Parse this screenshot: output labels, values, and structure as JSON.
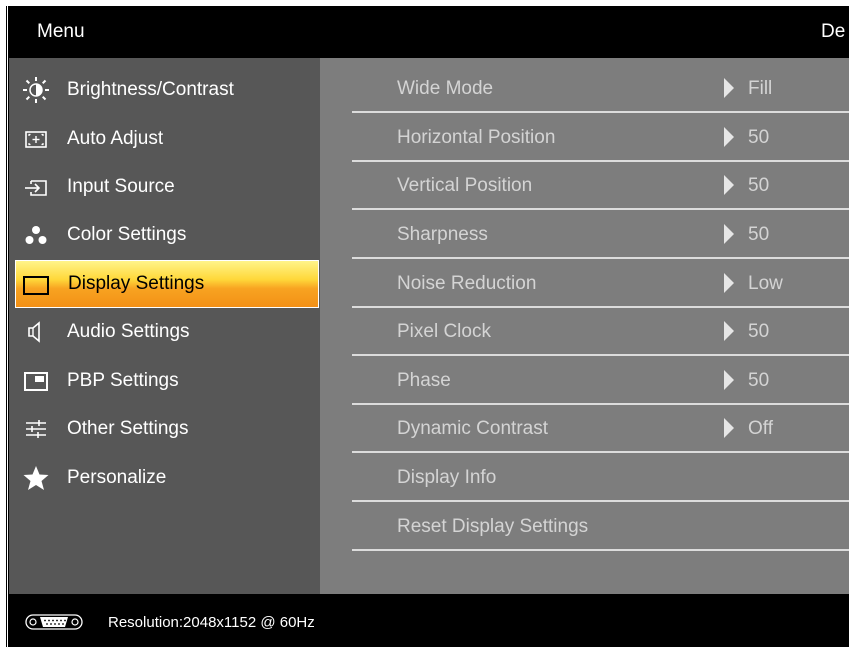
{
  "header": {
    "menu_title": "Menu",
    "brand_partial": "De"
  },
  "sidebar": {
    "items": [
      {
        "label": "Brightness/Contrast",
        "icon": "brightness-icon",
        "selected": false
      },
      {
        "label": "Auto Adjust",
        "icon": "auto-adjust-icon",
        "selected": false
      },
      {
        "label": "Input Source",
        "icon": "input-source-icon",
        "selected": false
      },
      {
        "label": "Color Settings",
        "icon": "color-settings-icon",
        "selected": false
      },
      {
        "label": "Display Settings",
        "icon": "display-settings-icon",
        "selected": true
      },
      {
        "label": "Audio Settings",
        "icon": "speaker-icon",
        "selected": false
      },
      {
        "label": "PBP Settings",
        "icon": "pbp-icon",
        "selected": false
      },
      {
        "label": "Other Settings",
        "icon": "sliders-icon",
        "selected": false
      },
      {
        "label": "Personalize",
        "icon": "star-icon",
        "selected": false
      }
    ]
  },
  "display_settings": {
    "rows": [
      {
        "label": "Wide Mode",
        "value": "Fill"
      },
      {
        "label": "Horizontal Position",
        "value": "50"
      },
      {
        "label": "Vertical Position",
        "value": "50"
      },
      {
        "label": "Sharpness",
        "value": "50"
      },
      {
        "label": "Noise Reduction",
        "value": "Low"
      },
      {
        "label": "Pixel Clock",
        "value": "50"
      },
      {
        "label": "Phase",
        "value": "50"
      },
      {
        "label": "Dynamic Contrast",
        "value": "Off"
      },
      {
        "label": "Display Info",
        "value": null
      },
      {
        "label": "Reset Display Settings",
        "value": null
      }
    ]
  },
  "status": {
    "connector_icon": "vga-connector-icon",
    "resolution": "Resolution:2048x1152 @ 60Hz"
  },
  "colors": {
    "sidebar_bg": "#575757",
    "content_bg": "#7d7d7d",
    "highlight_top": "#fff48a",
    "highlight_bottom": "#f39016"
  }
}
